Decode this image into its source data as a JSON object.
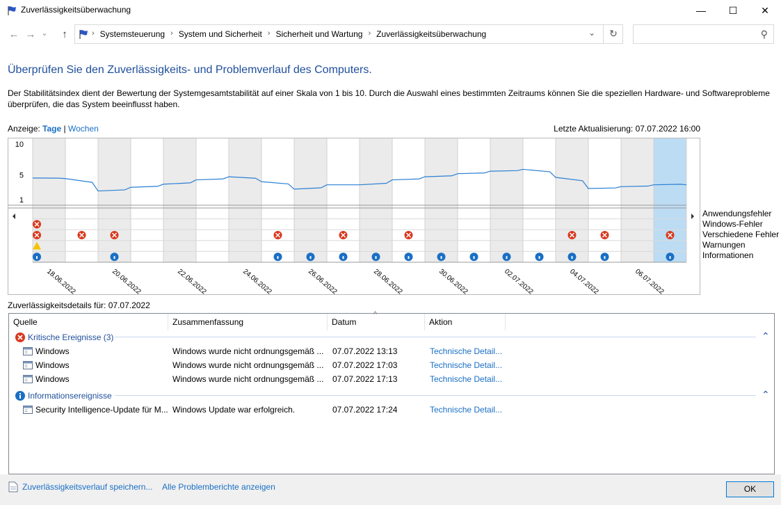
{
  "window": {
    "title": "Zuverlässigkeitsüberwachung",
    "minimize": "—",
    "maximize": "☐",
    "close": "✕"
  },
  "nav": {
    "back": "←",
    "forward": "→",
    "recent": "⌄",
    "up": "↑",
    "breadcrumbs": [
      "Systemsteuerung",
      "System und Sicherheit",
      "Sicherheit und Wartung",
      "Zuverlässigkeitsüberwachung"
    ],
    "dropdown": "⌄",
    "refresh": "↻",
    "search_placeholder": "",
    "search_icon": "⚲"
  },
  "main": {
    "heading": "Überprüfen Sie den Zuverlässigkeits- und Problemverlauf des Computers.",
    "description": "Der Stabilitätsindex dient der Bewertung der Systemgesamtstabilität auf einer Skala von 1 bis 10. Durch die Auswahl eines bestimmten Zeitraums können Sie die speziellen Hardware- und Softwareprobleme überprüfen, die das System beeinflusst haben.",
    "view_label": "Anzeige:",
    "view_days": "Tage",
    "view_sep": "|",
    "view_weeks": "Wochen",
    "last_update": "Letzte Aktualisierung: 07.07.2022 16:00"
  },
  "chart_data": {
    "type": "line",
    "y_ticks": [
      "10",
      "5",
      "1"
    ],
    "ylim": [
      1,
      10
    ],
    "dates": [
      "18.06.2022",
      "19.06.2022",
      "20.06.2022",
      "21.06.2022",
      "22.06.2022",
      "23.06.2022",
      "24.06.2022",
      "25.06.2022",
      "26.06.2022",
      "27.06.2022",
      "28.06.2022",
      "29.06.2022",
      "30.06.2022",
      "01.07.2022",
      "02.07.2022",
      "03.07.2022",
      "04.07.2022",
      "05.07.2022",
      "06.07.2022",
      "07.07.2022"
    ],
    "x_labels": [
      "18.06.2022",
      "20.06.2022",
      "22.06.2022",
      "24.06.2022",
      "26.06.2022",
      "28.06.2022",
      "30.06.2022",
      "02.07.2022",
      "04.07.2022",
      "06.07.2022"
    ],
    "stability_index": [
      4.5,
      4.4,
      2.4,
      3.0,
      3.5,
      4.2,
      4.7,
      3.9,
      2.7,
      3.4,
      3.4,
      4.2,
      4.7,
      5.2,
      5.6,
      5.9,
      4.6,
      2.8,
      3.1,
      3.4
    ],
    "weekend_shading": [
      true,
      false,
      true,
      false,
      true,
      false,
      true,
      false,
      true,
      false,
      true,
      false,
      true,
      false,
      true,
      false,
      true,
      false,
      true,
      false
    ],
    "selected_day": "07.07.2022",
    "event_rows": [
      "Anwendungsfehler",
      "Windows-Fehler",
      "Verschiedene Fehler",
      "Warnungen",
      "Informationen"
    ],
    "events": {
      "Anwendungsfehler": [],
      "Windows-Fehler": [
        "18.06.2022"
      ],
      "Verschiedene Fehler": [
        "18.06.2022",
        "19.06.2022",
        "20.06.2022",
        "25.06.2022",
        "27.06.2022",
        "29.06.2022",
        "04.07.2022",
        "05.07.2022",
        "07.07.2022"
      ],
      "Warnungen": [
        "18.06.2022"
      ],
      "Informationen": [
        "18.06.2022",
        "20.06.2022",
        "25.06.2022",
        "26.06.2022",
        "27.06.2022",
        "28.06.2022",
        "29.06.2022",
        "30.06.2022",
        "01.07.2022",
        "02.07.2022",
        "03.07.2022",
        "04.07.2022",
        "05.07.2022",
        "07.07.2022"
      ]
    },
    "colors": {
      "line": "#2a7fd4",
      "weekend": "#ebebeb",
      "selected": "#bcdcf4",
      "error": "#d9381e",
      "warning": "#f5c400",
      "info": "#1a6fc4"
    }
  },
  "details": {
    "label": "Zuverlässigkeitsdetails für: 07.07.2022",
    "columns": [
      "Quelle",
      "Zusammenfassung",
      "Datum",
      "Aktion"
    ],
    "sort_indicator": "^",
    "groups": [
      {
        "title": "Kritische Ereignisse (3)",
        "icon": "error-icon",
        "rows": [
          {
            "source": "Windows",
            "summary": "Windows wurde nicht ordnungsgemäß ...",
            "date": "07.07.2022 13:13",
            "action": "Technische Detail..."
          },
          {
            "source": "Windows",
            "summary": "Windows wurde nicht ordnungsgemäß ...",
            "date": "07.07.2022 17:03",
            "action": "Technische Detail..."
          },
          {
            "source": "Windows",
            "summary": "Windows wurde nicht ordnungsgemäß ...",
            "date": "07.07.2022 17:13",
            "action": "Technische Detail..."
          }
        ]
      },
      {
        "title": "Informationsereignisse",
        "icon": "info-icon",
        "rows": [
          {
            "source": "Security Intelligence-Update für M...",
            "summary": "Windows Update war erfolgreich.",
            "date": "07.07.2022 17:24",
            "action": "Technische Detail..."
          }
        ]
      }
    ],
    "collapse_glyph": "⌃"
  },
  "footer": {
    "save_history": "Zuverlässigkeitsverlauf speichern...",
    "all_reports": "Alle Problemberichte anzeigen",
    "ok": "OK"
  }
}
